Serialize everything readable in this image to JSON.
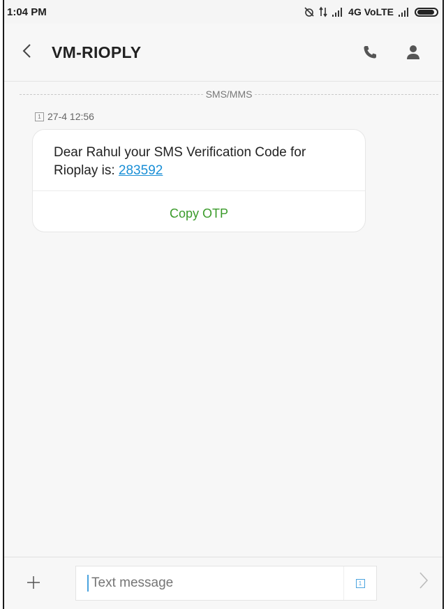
{
  "status_bar": {
    "time": "1:04 PM",
    "network_text": "4G VoLTE",
    "icons": [
      "alarm-off-icon",
      "data-arrows-icon",
      "signal-icon",
      "signal-icon",
      "battery-icon"
    ]
  },
  "header": {
    "title": "VM-RIOPLY",
    "icons": [
      "back-icon",
      "phone-icon",
      "contact-icon"
    ]
  },
  "thread": {
    "divider_label": "SMS/MMS",
    "message": {
      "sim_label": "1",
      "timestamp": "27-4 12:56",
      "text_before_link": "Dear Rahul  your SMS Verification Code for Rioplay is: ",
      "otp_code": "283592",
      "action_label": "Copy OTP"
    }
  },
  "composer": {
    "placeholder": "Text message",
    "sim_label": "1",
    "icons": [
      "plus-icon",
      "sim-icon",
      "send-icon"
    ]
  },
  "colors": {
    "link": "#1a8fd6",
    "action_green": "#3a9b2a",
    "cursor": "#4aa3df"
  }
}
